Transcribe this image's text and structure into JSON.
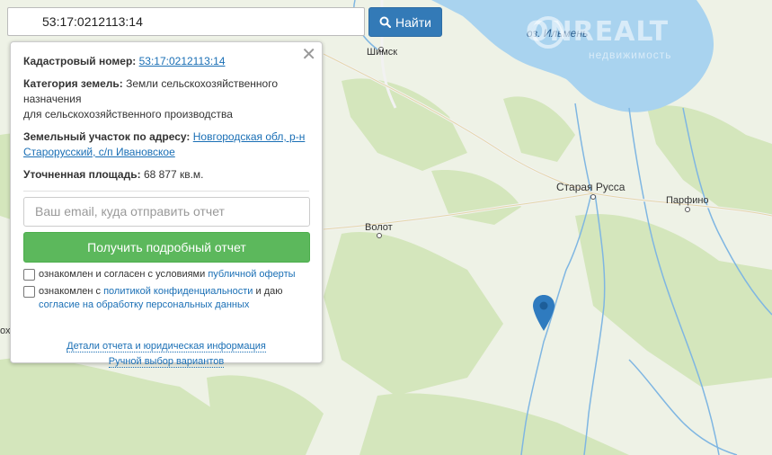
{
  "search": {
    "value": "53:17:0212113:14",
    "button_label": "Найти"
  },
  "map": {
    "labels": {
      "lake": "оз. Ильмень",
      "shimsk": "Шимск",
      "staraya_russa": "Старая Русса",
      "parfino": "Парфино",
      "volot": "Волот",
      "edge_letter": "ох"
    },
    "watermark": "ONREALT",
    "watermark_sub": "недвижимость",
    "colors": {
      "water": "#a9d3ef",
      "land": "#eef2e6",
      "forest": "#d4e6bc",
      "river": "#7fb6e2",
      "marker": "#2f7bbf"
    }
  },
  "panel": {
    "cadastral_label": "Кадастровый номер:",
    "cadastral_value": "53:17:0212113:14",
    "category_label": "Категория земель:",
    "category_value_1": "Земли сельскохозяйственного назначения",
    "category_value_2": "для сельскохозяйственного производства",
    "address_label": "Земельный участок по адресу:",
    "address_value": "Новгородская обл, р-н Старорусский, с/п Ивановское",
    "area_label": "Уточненная площадь:",
    "area_value": "68 877 кв.м.",
    "email_placeholder": "Ваш email, куда отправить отчет",
    "submit_label": "Получить подробный отчет",
    "check1_text": "ознакомлен и согласен с условиями",
    "check1_link": "публичной оферты",
    "check2_text": "ознакомлен с",
    "check2_link1": "политикой конфиденциальности",
    "check2_mid": "и даю",
    "check2_link2": "согласие на обработку персональных данных",
    "details_link": "Детали отчета и юридическая информация",
    "manual_link": "Ручной выбор вариантов"
  }
}
